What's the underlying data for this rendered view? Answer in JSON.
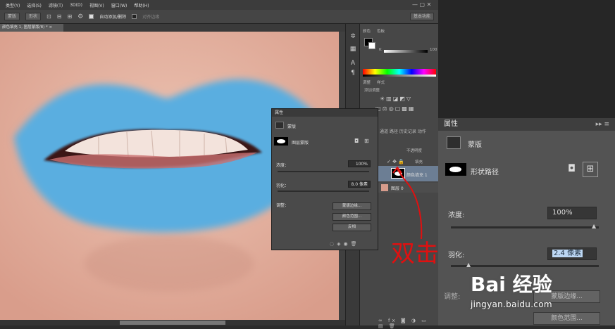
{
  "menu": [
    "类型(Y)",
    "选择(S)",
    "滤镜(T)",
    "3D(D)",
    "视图(V)",
    "窗口(W)",
    "帮助(H)"
  ],
  "options": {
    "btn1": "蒙版",
    "btn2": "形状",
    "auto_add": "自动添加/删除",
    "align_edges": "对齐边缘",
    "workspace": "基本功能"
  },
  "document_tab": "颜色填充 1, 图层蒙版/8) * ×",
  "right_panels": {
    "tab_color": "颜色",
    "tab_swatches": "色板",
    "k_label": "K",
    "k_value": "100",
    "tab_adjust": "调整",
    "tab_styles": "样式",
    "add_adjust": "添加调整",
    "opacity_label": "不透明度",
    "fill_label": "填充",
    "layers": [
      {
        "name": "颜色填充 1"
      },
      {
        "name": "图层 0"
      }
    ],
    "layer_tabs": [
      "通道",
      "路径",
      "历史记录",
      "动作"
    ]
  },
  "props_small": {
    "title": "属性",
    "mask_label": "蒙版",
    "path_label": "图层蒙版",
    "density_label": "浓度：",
    "density_value": "100%",
    "feather_label": "羽化：",
    "feather_value": "8.0 像素",
    "adjust_label": "调整：",
    "btn_mask_edge": "蒙版边缘...",
    "btn_color_range": "颜色范围...",
    "btn_invert": "反相"
  },
  "props_big": {
    "title": "属性",
    "mask_label": "蒙版",
    "path_label": "形状路径",
    "density_label": "浓度:",
    "density_value": "100%",
    "feather_label": "羽化:",
    "feather_value": "2.4 像素",
    "adjust_label": "调整:",
    "btn_mask_edge": "蒙版边缘...",
    "btn_color_range": "颜色范围..."
  },
  "annotation": "双击",
  "watermark": {
    "logo": "Bai 经验",
    "url": "jingyan.baidu.com"
  },
  "colors": {
    "lip_fill": "#5aaee0",
    "annotation": "#e01010"
  }
}
